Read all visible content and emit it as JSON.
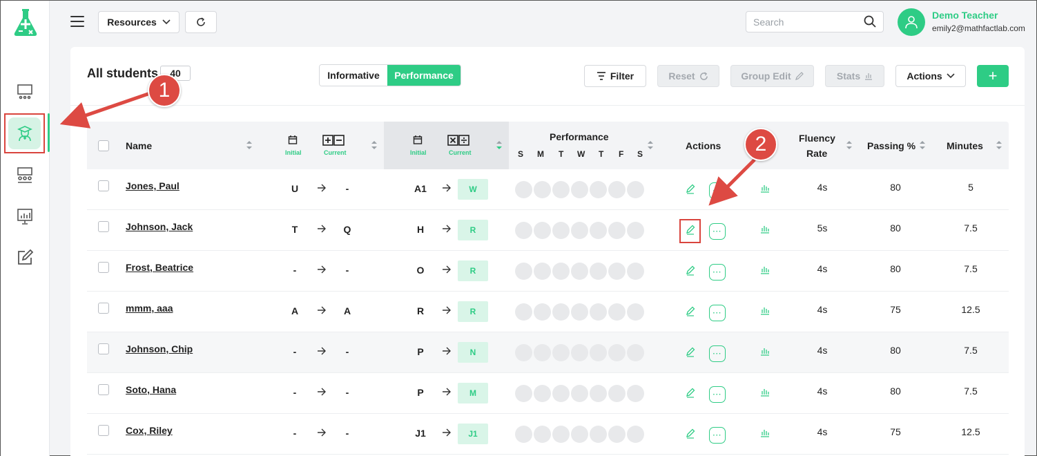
{
  "sidebar": {
    "items": [
      {
        "icon": "classroom-icon"
      },
      {
        "icon": "student-icon",
        "active": true
      },
      {
        "icon": "groups-icon"
      },
      {
        "icon": "reports-icon"
      },
      {
        "icon": "edit-notes-icon"
      }
    ]
  },
  "topbar": {
    "resources_label": "Resources",
    "search_placeholder": "Search",
    "user_name": "Demo Teacher",
    "user_email": "emily2@mathfactlab.com"
  },
  "toolbar": {
    "title": "All students",
    "count": "40",
    "tab_informative": "Informative",
    "tab_performance": "Performance",
    "filter_label": "Filter",
    "reset_label": "Reset",
    "group_edit_label": "Group Edit",
    "stats_label": "Stats",
    "actions_label": "Actions",
    "add_label": "+"
  },
  "table": {
    "headers": {
      "name": "Name",
      "initial": "Initial",
      "current": "Current",
      "performance": "Performance",
      "days": [
        "S",
        "M",
        "T",
        "W",
        "T",
        "F",
        "S"
      ],
      "actions": "Actions",
      "fluency_line1": "Fluency",
      "fluency_line2": "Rate",
      "passing": "Passing %",
      "minutes": "Minutes"
    },
    "rows": [
      {
        "name": "Jones, Paul",
        "add_init": "U",
        "add_cur": "-",
        "mul_init": "A1",
        "mul_cur": "W",
        "fluency": "4s",
        "passing": "80",
        "minutes": "5"
      },
      {
        "name": "Johnson, Jack",
        "add_init": "T",
        "add_cur": "Q",
        "mul_init": "H",
        "mul_cur": "R",
        "fluency": "5s",
        "passing": "80",
        "minutes": "7.5"
      },
      {
        "name": "Frost, Beatrice",
        "add_init": "-",
        "add_cur": "-",
        "mul_init": "O",
        "mul_cur": "R",
        "fluency": "4s",
        "passing": "80",
        "minutes": "7.5"
      },
      {
        "name": "mmm, aaa",
        "add_init": "A",
        "add_cur": "A",
        "mul_init": "R",
        "mul_cur": "R",
        "fluency": "4s",
        "passing": "75",
        "minutes": "12.5"
      },
      {
        "name": "Johnson, Chip",
        "add_init": "-",
        "add_cur": "-",
        "mul_init": "P",
        "mul_cur": "N",
        "fluency": "4s",
        "passing": "80",
        "minutes": "7.5"
      },
      {
        "name": "Soto, Hana",
        "add_init": "-",
        "add_cur": "-",
        "mul_init": "P",
        "mul_cur": "M",
        "fluency": "4s",
        "passing": "80",
        "minutes": "7.5"
      },
      {
        "name": "Cox, Riley",
        "add_init": "-",
        "add_cur": "-",
        "mul_init": "J1",
        "mul_cur": "J1",
        "fluency": "4s",
        "passing": "75",
        "minutes": "12.5"
      }
    ]
  },
  "callouts": [
    "1",
    "2"
  ],
  "colors": {
    "accent": "#2ecc85",
    "callout": "#dd4a43"
  }
}
